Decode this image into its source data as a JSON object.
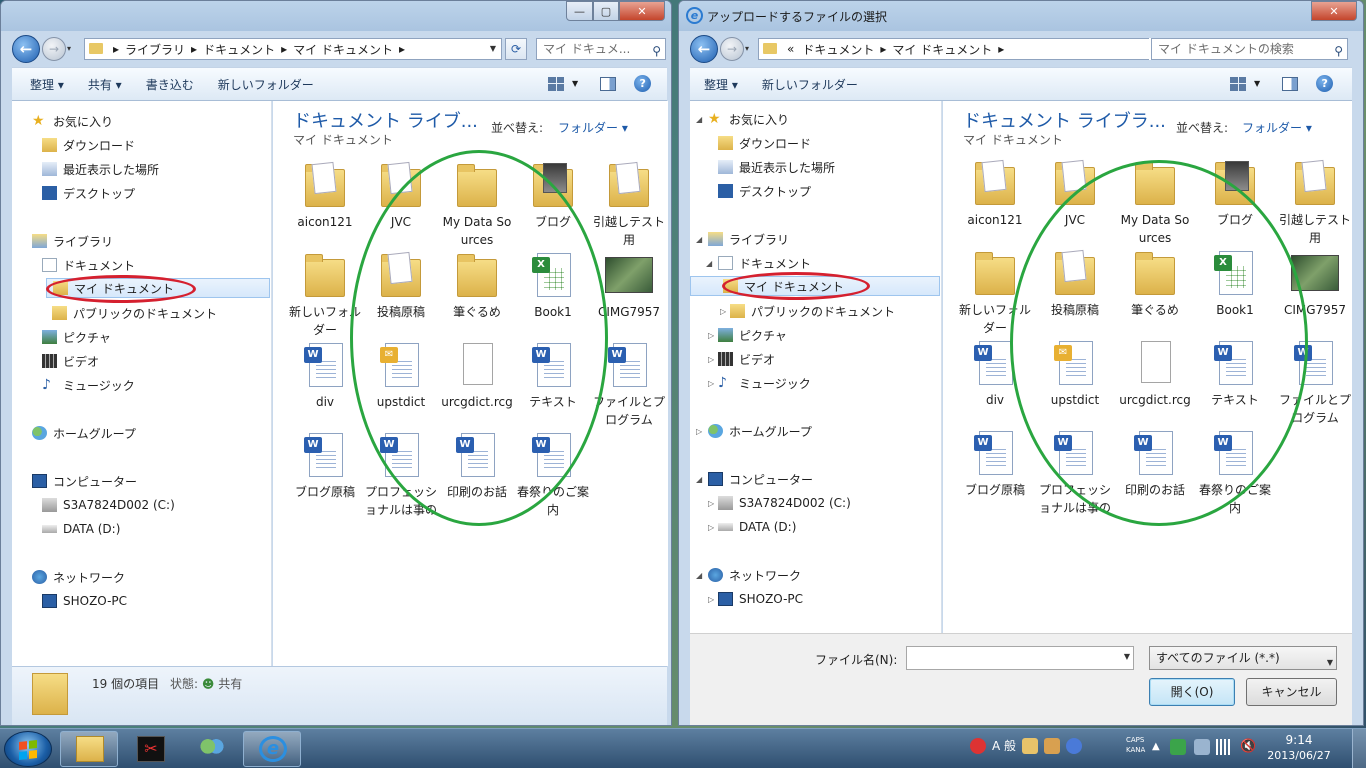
{
  "left": {
    "addr": [
      "ライブラリ",
      "ドキュメント",
      "マイ ドキュメント"
    ],
    "search_placeholder": "マイ ドキュメ...",
    "toolbar": [
      "整理 ▾",
      "共有 ▾",
      "書き込む",
      "新しいフォルダー"
    ],
    "nav": {
      "favorites": "お気に入り",
      "downloads": "ダウンロード",
      "recent": "最近表示した場所",
      "desktop": "デスクトップ",
      "libraries": "ライブラリ",
      "documents": "ドキュメント",
      "my_documents": "マイ ドキュメント",
      "public_documents": "パブリックのドキュメント",
      "pictures": "ピクチャ",
      "video": "ビデオ",
      "music": "ミュージック",
      "homegroup": "ホームグループ",
      "computer": "コンピューター",
      "drive_c": "S3A7824D002 (C:)",
      "drive_d": "DATA (D:)",
      "network": "ネットワーク",
      "pc": "SHOZO-PC"
    },
    "lib_title": "ドキュメント ライブ...",
    "lib_sub": "マイ ドキュメント",
    "sort_label": "並べ替え:",
    "sort_value": "フォルダー ▾",
    "details_count": "19 個の項目",
    "details_state_label": "状態:",
    "details_state_value": "共有"
  },
  "right": {
    "title": "アップロードするファイルの選択",
    "addr": [
      "«",
      "ドキュメント",
      "マイ ドキュメント"
    ],
    "search_placeholder": "マイ ドキュメントの検索",
    "toolbar": [
      "整理 ▾",
      "新しいフォルダー"
    ],
    "nav": {
      "favorites": "お気に入り",
      "downloads": "ダウンロード",
      "recent": "最近表示した場所",
      "desktop": "デスクトップ",
      "libraries": "ライブラリ",
      "documents": "ドキュメント",
      "my_documents": "マイ ドキュメント",
      "public_documents": "パブリックのドキュメント",
      "pictures": "ピクチャ",
      "video": "ビデオ",
      "music": "ミュージック",
      "homegroup": "ホームグループ",
      "computer": "コンピューター",
      "drive_c": "S3A7824D002 (C:)",
      "drive_d": "DATA (D:)",
      "network": "ネットワーク",
      "pc": "SHOZO-PC"
    },
    "lib_title": "ドキュメント ライブラ...",
    "lib_sub": "マイ ドキュメント",
    "sort_label": "並べ替え:",
    "sort_value": "フォルダー ▾",
    "filename_label": "ファイル名(N):",
    "filetype": "すべてのファイル (*.*)",
    "open": "開く(O)",
    "cancel": "キャンセル"
  },
  "files": [
    {
      "name": "aicon121",
      "kind": "folder-paper"
    },
    {
      "name": "JVC",
      "kind": "folder-paper"
    },
    {
      "name": "My Data Sources",
      "kind": "folder"
    },
    {
      "name": "ブログ",
      "kind": "folder-photo"
    },
    {
      "name": "引越しテスト用",
      "kind": "folder-paper"
    },
    {
      "name": "新しいフォルダー",
      "kind": "folder"
    },
    {
      "name": "投稿原稿",
      "kind": "folder-paper"
    },
    {
      "name": "筆ぐるめ",
      "kind": "folder"
    },
    {
      "name": "Book1",
      "kind": "excel"
    },
    {
      "name": "CIMG7957",
      "kind": "image"
    },
    {
      "name": "div",
      "kind": "word"
    },
    {
      "name": "upstdict",
      "kind": "outlook"
    },
    {
      "name": "urcgdict.rcg",
      "kind": "blank"
    },
    {
      "name": "テキスト",
      "kind": "word"
    },
    {
      "name": "ファイルとプログラム",
      "kind": "word"
    },
    {
      "name": "ブログ原稿",
      "kind": "word"
    },
    {
      "name": "プロフェッショナルは事の流儀",
      "kind": "word"
    },
    {
      "name": "印刷のお話",
      "kind": "word"
    },
    {
      "name": "春祭りのご案内",
      "kind": "word"
    }
  ],
  "taskbar": {
    "ime": "A 般",
    "caps": "CAPS",
    "kana": "KANA",
    "time": "9:14",
    "date": "2013/06/27"
  }
}
